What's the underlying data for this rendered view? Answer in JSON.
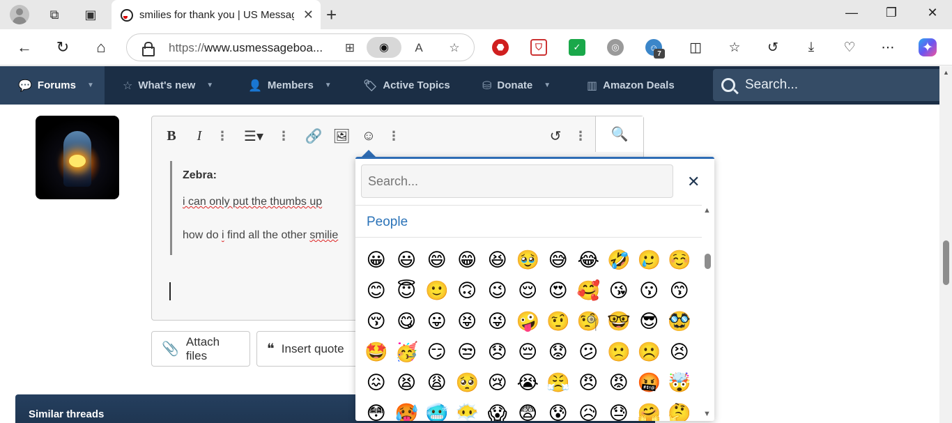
{
  "browser": {
    "tab_title": "smilies for thank you | US Message Board - Political Discussion Forum",
    "tab_close": "✕",
    "new_tab": "+",
    "url_scheme": "https://",
    "url_host": "www.usmessageboa...",
    "extension_badge": "7",
    "window_controls": {
      "minimize": "—",
      "maximize": "❐",
      "close": "✕"
    }
  },
  "site_nav": {
    "items": [
      {
        "label": "Forums",
        "icon": "chat-icon"
      },
      {
        "label": "What's new",
        "icon": "star-icon"
      },
      {
        "label": "Members",
        "icon": "user-icon"
      },
      {
        "label": "Active Topics",
        "icon": "tag-icon"
      },
      {
        "label": "Donate",
        "icon": "donate-icon"
      },
      {
        "label": "Amazon Deals",
        "icon": "books-icon"
      }
    ],
    "search_placeholder": "Search..."
  },
  "editor": {
    "quote_author": "Zebra:",
    "quote_line1": "i can only put the thumbs up",
    "quote_line2_prefix": "how do ",
    "quote_line2_i": "i",
    "quote_line2_mid": " find all the other ",
    "quote_line2_sq": "smilie"
  },
  "buttons": {
    "attach": "Attach files",
    "insert_quote": "Insert quote"
  },
  "similar_threads": "Similar threads",
  "emoji_popup": {
    "search_placeholder": "Search...",
    "close": "✕",
    "category": "People",
    "emojis": [
      "😀",
      "😃",
      "😄",
      "😁",
      "😆",
      "🥹",
      "😅",
      "😂",
      "🤣",
      "🥲",
      "☺️",
      "😊",
      "😇",
      "🙂",
      "🙃",
      "😉",
      "😌",
      "😍",
      "🥰",
      "😘",
      "😗",
      "😙",
      "😚",
      "😋",
      "😛",
      "😝",
      "😜",
      "🤪",
      "🤨",
      "🧐",
      "🤓",
      "😎",
      "🥸",
      "🤩",
      "🥳",
      "😏",
      "😒",
      "😞",
      "😔",
      "😟",
      "😕",
      "🙁",
      "☹️",
      "😣",
      "😖",
      "😫",
      "😩",
      "🥺",
      "😢",
      "😭",
      "😤",
      "😠",
      "😡",
      "🤬",
      "🤯",
      "😳",
      "🥵",
      "🥶",
      "😶‍🌫️",
      "😱",
      "😨",
      "😰",
      "😥",
      "😓",
      "🤗",
      "🤔"
    ]
  }
}
